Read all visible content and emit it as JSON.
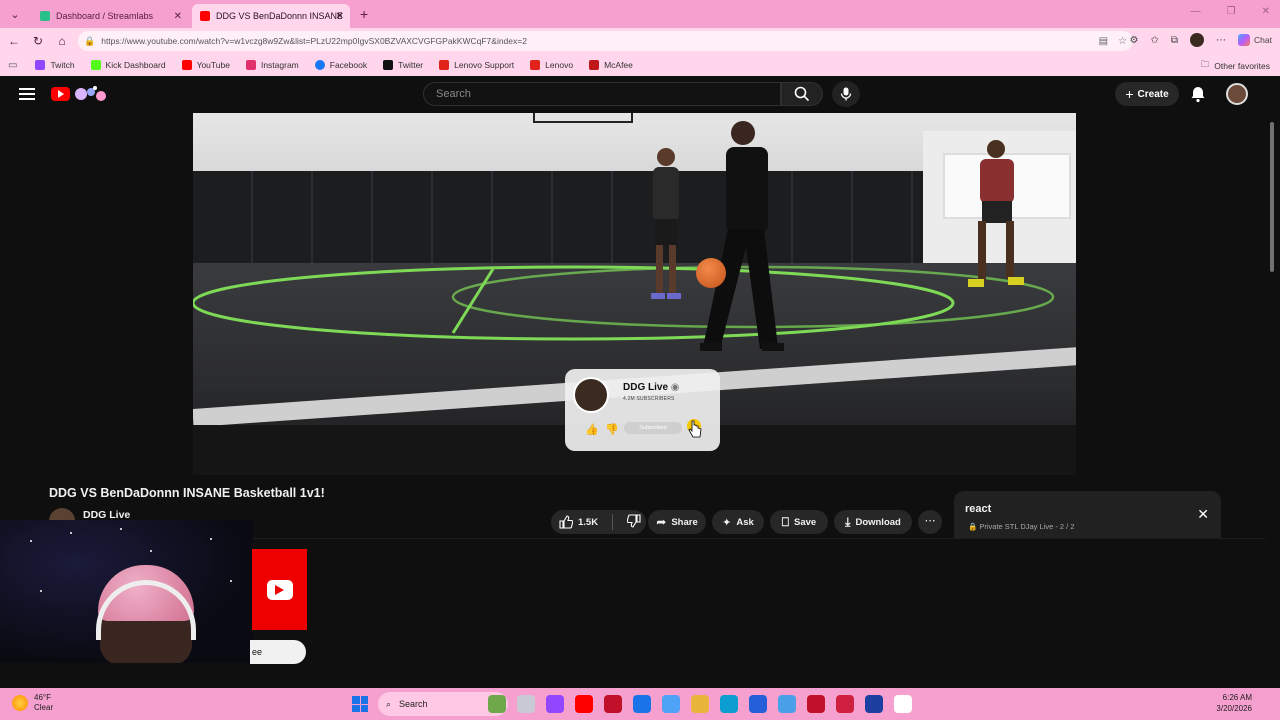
{
  "browser": {
    "tabs": [
      {
        "title": "Dashboard / Streamlabs",
        "active": false,
        "favicon_color": "#2bbf8b"
      },
      {
        "title": "DDG VS BenDaDonnn INSANE Ba",
        "active": true,
        "favicon_color": "#ff0000"
      }
    ],
    "url": "https://www.youtube.com/watch?v=w1vczg8w9Zw&list=PLzU22mp0IgvSX0BZVAXCVGFGPakKWCqF7&index=2",
    "chat_label": "Chat",
    "bookmarks": [
      {
        "label": "Twitch",
        "color": "#9146ff"
      },
      {
        "label": "Kick Dashboard",
        "color": "#53fc18"
      },
      {
        "label": "YouTube",
        "color": "#ff0000"
      },
      {
        "label": "Instagram",
        "color": "#e1306c"
      },
      {
        "label": "Facebook",
        "color": "#1877f2"
      },
      {
        "label": "Twitter",
        "color": "#111111"
      },
      {
        "label": "Lenovo Support",
        "color": "#e2231a"
      },
      {
        "label": "Lenovo",
        "color": "#e2231a"
      },
      {
        "label": "McAfee",
        "color": "#c01818"
      }
    ],
    "other_favorites": "Other favorites"
  },
  "youtube": {
    "search_placeholder": "Search",
    "create_label": "Create",
    "video": {
      "title": "DDG VS BenDaDonnn INSANE Basketball 1v1!",
      "channel": "DDG Live",
      "overlay_channel": "DDG Live",
      "overlay_subs": "4.2M SUBSCRIBERS",
      "overlay_subscribed": "Subscribed"
    },
    "actions": {
      "likes": "1.5K",
      "share": "Share",
      "ask": "Ask",
      "save": "Save",
      "download": "Download"
    },
    "playlist": {
      "title": "react",
      "meta": "Private  STL DJay Live - 2 / 2"
    }
  },
  "webcam": {
    "pill_text": "ee"
  },
  "taskbar": {
    "temperature": "46°F",
    "condition": "Clear",
    "search_label": "Search",
    "time": "6:26 AM",
    "date": "3/20/2026",
    "app_colors": [
      "#6ea84a",
      "#c9c9d6",
      "#9146ff",
      "#ff0000",
      "#c0102a",
      "#1a74e8",
      "#4fa3f7",
      "#e8b43a",
      "#0c9ed1",
      "#2560d8",
      "#4aa0e8",
      "#c0102a",
      "#d02040",
      "#1d3fa0",
      "#ffffff"
    ]
  }
}
